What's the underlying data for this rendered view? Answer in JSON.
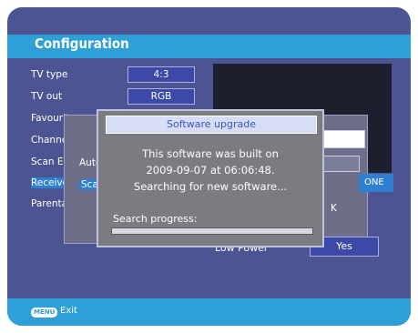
{
  "screen": {
    "title": "Configuration",
    "menu": [
      {
        "label": "TV type",
        "value": "4:3"
      },
      {
        "label": "TV out",
        "value": "RGB"
      },
      {
        "label": "Favourite mo",
        "value": ""
      },
      {
        "label": "Channel",
        "value": ""
      },
      {
        "label": "Scan En",
        "value": ""
      },
      {
        "label": "Receive",
        "value": ""
      },
      {
        "label": "Parental cont",
        "value": ""
      }
    ],
    "inner_dialog": {
      "row1": "Auto",
      "row2": "Sca",
      "ok_fragment": "K",
      "one_label": "ONE"
    },
    "low_power_label": "Low Power",
    "low_power_value": "Yes",
    "footer": {
      "key_label": "MENU",
      "exit_label": "Exit"
    }
  },
  "modal": {
    "title": "Software upgrade",
    "line1": "This software was built on",
    "line2": "2009-09-07 at 06:06:48.",
    "line3": "Searching for new software...",
    "progress_label": "Search progress:",
    "progress_fraction": 0.0
  },
  "colors": {
    "background": "#4c5592",
    "accent": "#2f9fd8",
    "modal_bg": "#7b7b82"
  }
}
